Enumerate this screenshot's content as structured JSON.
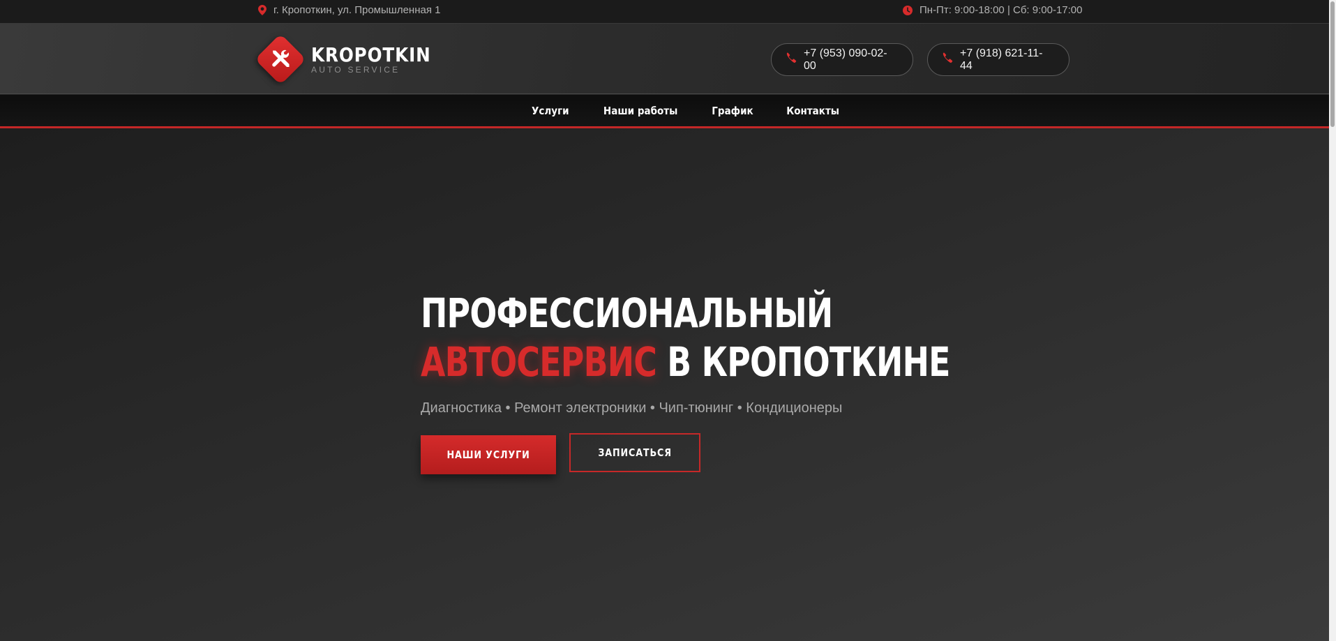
{
  "topbar": {
    "address": "г. Кропоткин, ул. Промышленная 1",
    "address_icon": "map-pin-icon",
    "hours": "Пн-Пт: 9:00-18:00 | Сб: 9:00-17:00",
    "hours_icon": "clock-icon"
  },
  "brand": {
    "name": "KROPOTKIN",
    "tagline": "AUTO SERVICE",
    "logo_icon": "wrench-screwdriver-icon"
  },
  "phones": [
    {
      "number": "+7 (953) 090-02-00",
      "icon": "phone-icon"
    },
    {
      "number": "+7 (918) 621-11-44",
      "icon": "phone-icon"
    }
  ],
  "nav": {
    "items": [
      "Услуги",
      "Наши работы",
      "График",
      "Контакты"
    ]
  },
  "hero": {
    "title_line1": "ПРОФЕССИОНАЛЬНЫЙ",
    "title_accent": "АВТОСЕРВИС",
    "title_rest": " В КРОПОТКИНЕ",
    "subtitle": "Диагностика • Ремонт электроники • Чип-тюнинг • Кондиционеры",
    "primary_button": "НАШИ УСЛУГИ",
    "secondary_button": "ЗАПИСАТЬСЯ"
  },
  "colors": {
    "accent": "#d72b2b",
    "background": "#232323",
    "text": "#ffffff",
    "muted_text": "#a9a9a9"
  }
}
